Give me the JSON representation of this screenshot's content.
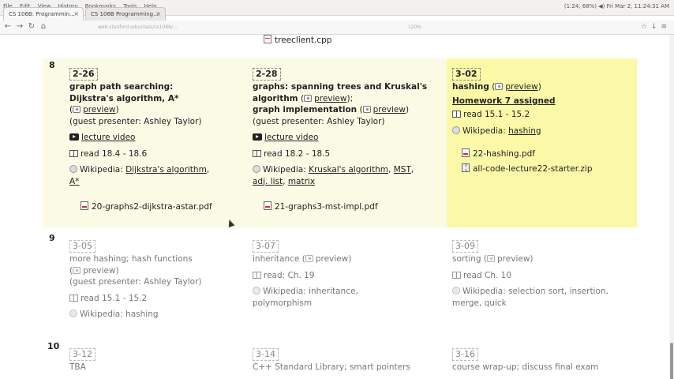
{
  "system": {
    "menus": [
      "File",
      "Edit",
      "View",
      "History",
      "Bookmarks",
      "Tools",
      "Help"
    ],
    "tray_text": "(1:24, 68%)   ◀)   Fri Mar 2, 11:24:31 AM"
  },
  "browser": {
    "tabs": [
      {
        "label": "CS 106B: Programmin..."
      },
      {
        "label": "CS 106B Programming..."
      }
    ],
    "url": "web.stanford.edu/class/cs106b/...",
    "zoom": "120%"
  },
  "page": {
    "top_file": "treeclient.cpp",
    "weeks": [
      {
        "number": "8",
        "days": [
          {
            "date": "2-26",
            "topic_lines": [
              "graph path searching:",
              "Dijkstra's algorithm, A*"
            ],
            "preview_label": "preview",
            "presenter": "(guest presenter: Ashley Taylor)",
            "video": "lecture video",
            "read": "read 18.4 - 18.6",
            "wiki_prefix": "Wikipedia:",
            "wiki_links": [
              "Dijkstra's algorithm",
              "A*"
            ],
            "file": "20-graphs2-dijkstra-astar.pdf"
          },
          {
            "date": "2-28",
            "topic_lines": [
              "graphs: spanning trees and Kruskal's",
              "algorithm",
              "graph implementation"
            ],
            "preview_label": "preview",
            "presenter": "(guest presenter: Ashley Taylor)",
            "video": "lecture video",
            "read": "read 18.2 - 18.5",
            "wiki_prefix": "Wikipedia:",
            "wiki_links": [
              "Kruskal's algorithm",
              "MST",
              "adj. list",
              "matrix"
            ],
            "file": "21-graphs3-mst-impl.pdf"
          },
          {
            "date": "3-02",
            "topic": "hashing",
            "preview_label": "preview",
            "homework": "Homework 7 assigned",
            "read": "read 15.1 - 15.2",
            "wiki_prefix": "Wikipedia:",
            "wiki_links": [
              "hashing"
            ],
            "files": [
              "22-hashing.pdf",
              "all-code-lecture22-starter.zip"
            ]
          }
        ]
      },
      {
        "number": "9",
        "days": [
          {
            "date": "3-05",
            "topic": "more hashing; hash functions",
            "preview_label": "preview",
            "presenter": "(guest presenter: Ashley Taylor)",
            "read": "read 15.1 - 15.2",
            "wiki": "Wikipedia: hashing"
          },
          {
            "date": "3-07",
            "topic": "inheritance",
            "preview_label": "preview",
            "read": "read: Ch. 19",
            "wiki_lines": [
              "Wikipedia: inheritance,",
              "polymorphism"
            ]
          },
          {
            "date": "3-09",
            "topic": "sorting",
            "preview_label": "preview",
            "read": "read Ch. 10",
            "wiki_lines": [
              "Wikipedia: selection sort, insertion,",
              "merge, quick"
            ]
          }
        ]
      },
      {
        "number": "10",
        "days": [
          {
            "date": "3-12",
            "topic": "TBA"
          },
          {
            "date": "3-14",
            "topic": "C++ Standard Library; smart pointers"
          },
          {
            "date": "3-16",
            "topic": "course wrap-up; discuss final exam"
          }
        ]
      }
    ]
  }
}
